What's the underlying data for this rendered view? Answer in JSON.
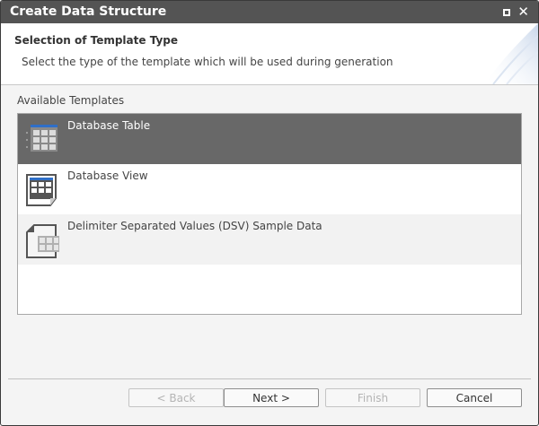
{
  "window": {
    "title": "Create Data Structure"
  },
  "header": {
    "title": "Selection of Template Type",
    "description": "Select the type of the template which will be used during generation"
  },
  "templates": {
    "label": "Available Templates",
    "items": [
      {
        "label": "Database Table",
        "icon": "database-table-icon",
        "selected": true
      },
      {
        "label": "Database View",
        "icon": "database-view-icon",
        "selected": false
      },
      {
        "label": "Delimiter Separated Values (DSV) Sample Data",
        "icon": "dsv-file-icon",
        "selected": false
      }
    ]
  },
  "buttons": {
    "back": "< Back",
    "next": "Next >",
    "finish": "Finish",
    "cancel": "Cancel"
  },
  "colors": {
    "titlebar": "#545454",
    "selected_row": "#686868",
    "accent": "#2f6fc8"
  }
}
